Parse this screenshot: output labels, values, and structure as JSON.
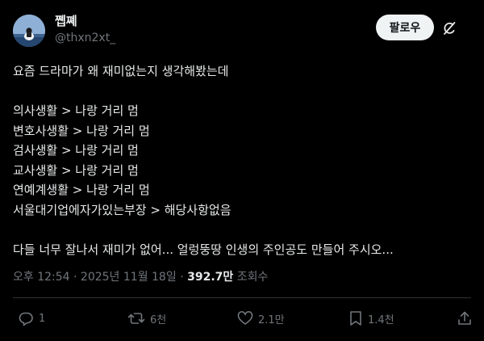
{
  "author": {
    "display_name": "쪱쪠",
    "handle": "@thxn2xt_"
  },
  "header": {
    "follow_label": "팔로우",
    "grok_icon": "grok-icon"
  },
  "tweet": {
    "lines": [
      "요즘 드라마가 왜 재미없는지 생각해봤는데",
      "",
      "의사생활 > 나랑 거리 멈",
      "변호사생활 > 나랑 거리 멈",
      "검사생활 > 나랑 거리 멈",
      "교사생활 > 나랑 거리 멈",
      "연예계생활 > 나랑 거리 멈",
      "서울대기업에자가있는부장 > 해당사항없음",
      "",
      "다들 너무 잘나서 재미가 없어... 얼렁뚱땅 인생의 주인공도 만들어 주시오..."
    ]
  },
  "meta": {
    "time": "오후 12:54",
    "separator": "·",
    "date": "2025년 11월 18일",
    "views_count": "392.7만",
    "views_label": "조회수"
  },
  "actions": {
    "reply_count": "1",
    "retweet_count": "6천",
    "like_count": "2.1만",
    "bookmark_count": "1.4천"
  },
  "colors": {
    "background": "#000000",
    "text_primary": "#e7e9ea",
    "text_secondary": "#71767b",
    "follow_bg": "#eff3f4",
    "divider": "#2f3336"
  }
}
